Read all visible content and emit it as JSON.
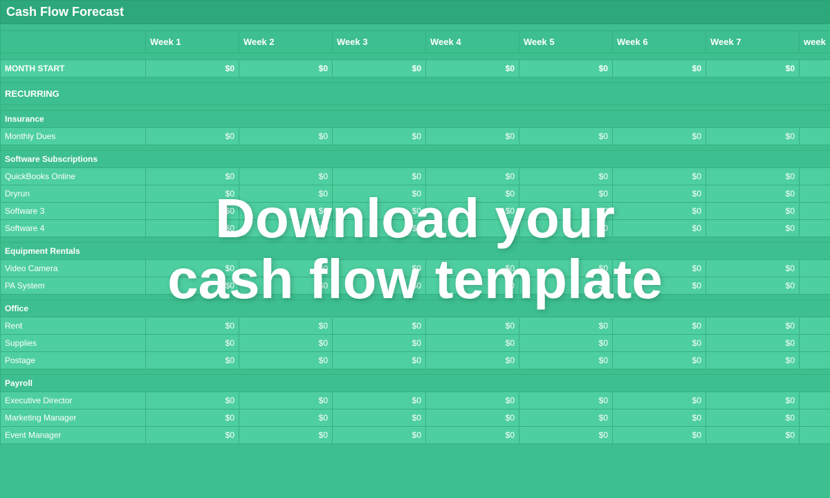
{
  "title": "Cash Flow Forecast",
  "overlay": {
    "line1": "Download your",
    "line2": "cash flow template"
  },
  "columns": {
    "label": "",
    "weeks": [
      "Week 1",
      "Week 2",
      "Week 3",
      "Week 4",
      "Week 5",
      "Week 6",
      "Week 7",
      "week"
    ]
  },
  "sections": {
    "monthStart": {
      "label": "MONTH START",
      "values": [
        "$0",
        "$0",
        "$0",
        "$0",
        "$0",
        "$0",
        "$0"
      ]
    },
    "recurring": {
      "label": "RECURRING",
      "categories": [
        {
          "name": "Insurance",
          "items": [
            {
              "label": "Monthly Dues",
              "values": [
                "$0",
                "$0",
                "$0",
                "$0",
                "$0",
                "$0",
                "$0"
              ]
            }
          ]
        },
        {
          "name": "Software Subscriptions",
          "items": [
            {
              "label": "QuickBooks Online",
              "values": [
                "$0",
                "$0",
                "$0",
                "$0",
                "$0",
                "$0",
                "$0"
              ]
            },
            {
              "label": "Dryrun",
              "values": [
                "$0",
                "$0",
                "$0",
                "$0",
                "$0",
                "$0",
                "$0"
              ]
            },
            {
              "label": "Software 3",
              "values": [
                "$0",
                "$0",
                "$0",
                "$0",
                "$0",
                "$0",
                "$0"
              ]
            },
            {
              "label": "Software 4",
              "values": [
                "$0",
                "$0",
                "$0",
                "$0",
                "$0",
                "$0",
                "$0"
              ]
            }
          ]
        },
        {
          "name": "Equipment Rentals",
          "items": [
            {
              "label": "Video Camera",
              "values": [
                "$0",
                "$0",
                "$0",
                "$0",
                "$0",
                "$0",
                "$0"
              ]
            },
            {
              "label": "PA System",
              "values": [
                "$0",
                "$0",
                "$0",
                "$0",
                "$0",
                "$0",
                "$0"
              ]
            }
          ]
        },
        {
          "name": "Office",
          "items": [
            {
              "label": "Rent",
              "values": [
                "$0",
                "$0",
                "$0",
                "$0",
                "$0",
                "$0",
                "$0"
              ]
            },
            {
              "label": "Supplies",
              "values": [
                "$0",
                "$0",
                "$0",
                "$0",
                "$0",
                "$0",
                "$0"
              ]
            },
            {
              "label": "Postage",
              "values": [
                "$0",
                "$0",
                "$0",
                "$0",
                "$0",
                "$0",
                "$0"
              ]
            }
          ]
        },
        {
          "name": "Payroll",
          "items": [
            {
              "label": "Executive Director",
              "values": [
                "$0",
                "$0",
                "$0",
                "$0",
                "$0",
                "$0",
                "$0"
              ]
            },
            {
              "label": "Marketing Manager",
              "values": [
                "$0",
                "$0",
                "$0",
                "$0",
                "$0",
                "$0",
                "$0"
              ]
            },
            {
              "label": "Event Manager",
              "values": [
                "$0",
                "$0",
                "$0",
                "$0",
                "$0",
                "$0",
                "$0"
              ]
            }
          ]
        }
      ]
    }
  }
}
